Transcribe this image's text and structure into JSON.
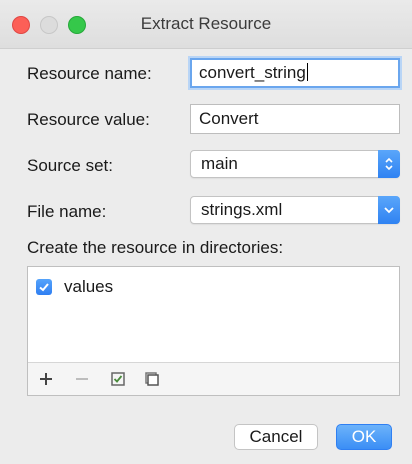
{
  "window": {
    "title": "Extract Resource"
  },
  "form": {
    "resource_name_label": "Resource name:",
    "resource_name_value": "convert_string",
    "resource_value_label": "Resource value:",
    "resource_value_value": "Convert",
    "source_set_label": "Source set:",
    "source_set_value": "main",
    "file_name_label": "File name:",
    "file_name_value": "strings.xml",
    "directories_label": "Create the resource in directories:"
  },
  "directories": {
    "items": [
      {
        "label": "values",
        "checked": true
      }
    ]
  },
  "buttons": {
    "cancel": "Cancel",
    "ok": "OK"
  },
  "colors": {
    "accent": "#3b8ef5",
    "close": "#fc5f57",
    "maximize": "#35c84a"
  },
  "icons": {
    "toolbar": [
      "add-icon",
      "remove-icon",
      "select-all-icon",
      "unselect-all-icon"
    ],
    "source_set_select": "up-down-chevron-icon",
    "file_name_select": "chevron-down-icon"
  }
}
